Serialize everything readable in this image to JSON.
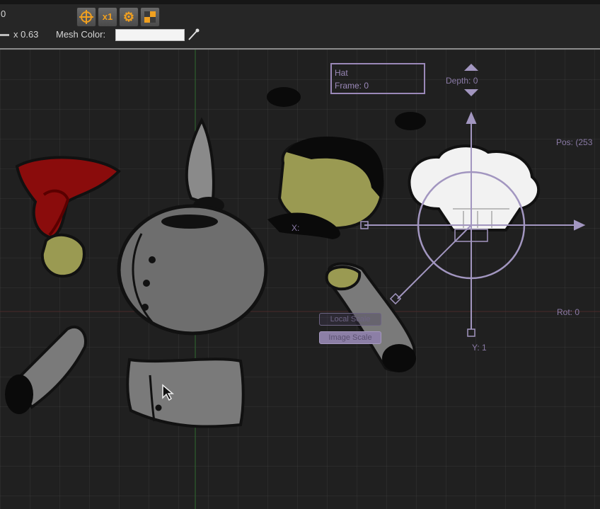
{
  "toolbar": {
    "top_value": "0",
    "scale_text": "x 0.63",
    "mesh_color_label": "Mesh Color:",
    "mesh_color": "#f4f4f4",
    "multiplier_label": "x1",
    "icons": [
      "crosshair-icon",
      "x1-toggle",
      "gear-icon",
      "checker-icon",
      "eyedropper-icon"
    ]
  },
  "gizmo": {
    "frame_box_line1": "Hat",
    "frame_box_line2": "Frame: 0",
    "depth_label": "Depth: 0",
    "pos_label": "Pos: (253",
    "rot_label": "Rot: 0",
    "x_label": "X:",
    "y_label": "Y: 1",
    "local_scale_label": "Local Scale",
    "image_scale_label": "Image Scale",
    "accent_color": "#9a88b8"
  }
}
